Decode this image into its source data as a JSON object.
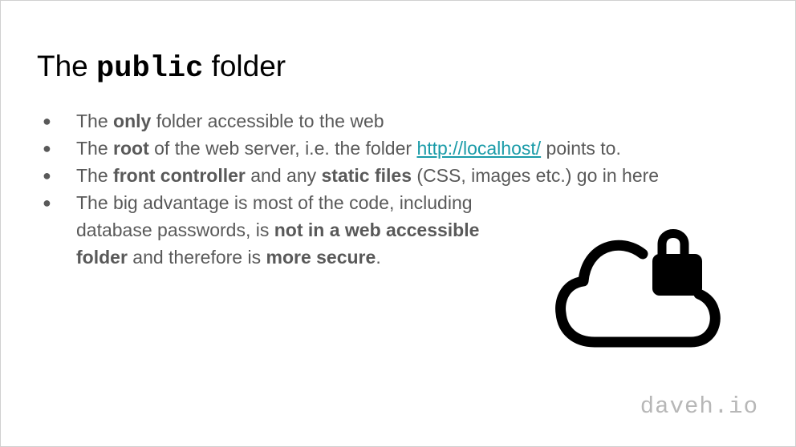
{
  "slide": {
    "title_pre": "The ",
    "title_code": "public",
    "title_post": " folder",
    "bullets": [
      {
        "t1": "The ",
        "b1": "only",
        "t2": " folder accessible to the web"
      },
      {
        "t1": "The ",
        "b1": "root",
        "t2": " of the web server, i.e. the folder ",
        "link": "http://localhost/",
        "t3": " points to."
      },
      {
        "t1": "The ",
        "b1": "front controller",
        "t2": " and any ",
        "b2": "static files",
        "t3": " (CSS, images etc.) go in here"
      },
      {
        "t1": "The big advantage is most of the code, including database passwords, is ",
        "b1": "not in a web accessible folder",
        "t2": " and therefore is ",
        "b2": "more secure",
        "t3": "."
      }
    ],
    "bullet_glyph": "●",
    "icon": "cloud-lock-icon",
    "brand": "daveh.io"
  },
  "colors": {
    "text": "#595959",
    "title": "#000000",
    "link": "#1a9ba8",
    "brand": "#b7b7b7"
  }
}
